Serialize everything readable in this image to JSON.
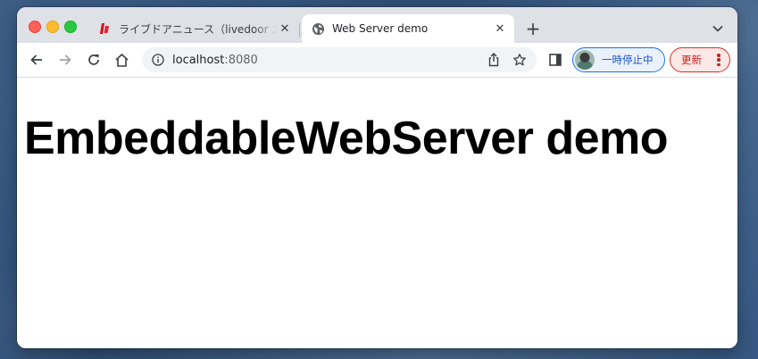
{
  "browser": {
    "tabs": [
      {
        "title": "ライブドアニュース（livedoor ニュース）",
        "favicon": "livedoor-news-icon",
        "active": false
      },
      {
        "title": "Web Server demo",
        "favicon": "globe-icon",
        "active": true
      }
    ],
    "address": {
      "host": "localhost",
      "port": ":8080"
    },
    "profile_label": "一時停止中",
    "update_label": "更新"
  },
  "page": {
    "heading": "EmbeddableWebServer demo"
  },
  "colors": {
    "tabstrip": "#dee1e6",
    "accent_blue": "#1a73e8",
    "update_red": "#d93025"
  }
}
